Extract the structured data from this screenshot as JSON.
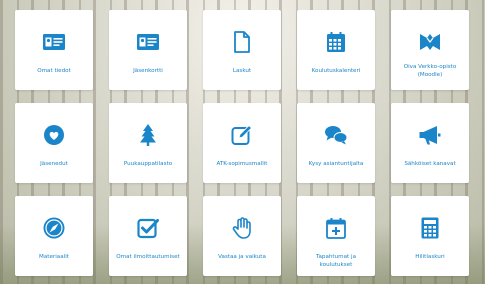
{
  "colors": {
    "accent": "#1b85c9",
    "tile_bg": "#ffffff"
  },
  "tiles": [
    {
      "label": "Omat tiedot",
      "icon": "id-card-icon"
    },
    {
      "label": "Jäsenkortti",
      "icon": "member-card-icon"
    },
    {
      "label": "Laskut",
      "icon": "document-icon"
    },
    {
      "label": "Koulutuskalenteri",
      "icon": "calendar-icon"
    },
    {
      "label": "Oiva Verkko-opisto\n(Moodle)",
      "icon": "oiva-logo-icon"
    },
    {
      "label": "Jäsenedut",
      "icon": "heart-icon"
    },
    {
      "label": "Puukauppatilasto",
      "icon": "tree-icon"
    },
    {
      "label": "ATK-sopimusmallit",
      "icon": "edit-icon"
    },
    {
      "label": "Kysy asiantuntijalta",
      "icon": "chat-icon"
    },
    {
      "label": "Sähköiset kanavat",
      "icon": "megaphone-icon"
    },
    {
      "label": "Materiaalit",
      "icon": "compass-icon"
    },
    {
      "label": "Omat ilmoittautumiset",
      "icon": "checkbox-icon"
    },
    {
      "label": "Vastaa ja vaikuta",
      "icon": "hand-icon"
    },
    {
      "label": "Tapahtumat ja koulutukset",
      "icon": "calendar-plus-icon"
    },
    {
      "label": "Hilitlaskuri",
      "icon": "calculator-icon"
    }
  ]
}
